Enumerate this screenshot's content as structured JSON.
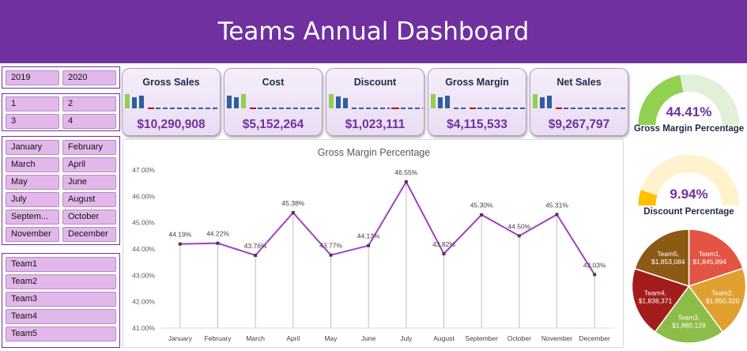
{
  "header": {
    "title": "Teams Annual Dashboard"
  },
  "slicers": {
    "years": [
      "2019",
      "2020"
    ],
    "quarters": [
      "1",
      "2",
      "3",
      "4"
    ],
    "months": [
      "January",
      "February",
      "March",
      "April",
      "May",
      "June",
      "July",
      "August",
      "Septem...",
      "October",
      "November",
      "December"
    ],
    "teams": [
      "Team1",
      "Team2",
      "Team3",
      "Team4",
      "Team5"
    ]
  },
  "kpis": [
    {
      "title": "Gross Sales",
      "value": "$10,290,908"
    },
    {
      "title": "Cost",
      "value": "$5,152,264"
    },
    {
      "title": "Discount",
      "value": "$1,023,111"
    },
    {
      "title": "Gross Margin",
      "value": "$4,115,533"
    },
    {
      "title": "Net Sales",
      "value": "$9,267,797"
    }
  ],
  "gauges": {
    "gross_margin": {
      "percent": "44.41%",
      "label": "Gross Margin Percentage",
      "fraction": 0.4441,
      "fill_color": "#92d050",
      "track_color": "#e2f0d9"
    },
    "discount": {
      "percent": "9.94%",
      "label": "Discount Percentage",
      "fraction": 0.0994,
      "fill_color": "#ffc000",
      "track_color": "#fff2cc"
    }
  },
  "chart_data": [
    {
      "type": "line",
      "title": "Gross Margin Percentage",
      "x": [
        "January",
        "February",
        "March",
        "April",
        "May",
        "June",
        "July",
        "August",
        "September",
        "October",
        "November",
        "December"
      ],
      "values": [
        44.19,
        44.22,
        43.76,
        45.38,
        43.77,
        44.13,
        46.55,
        43.82,
        45.3,
        44.5,
        45.31,
        43.03
      ],
      "data_labels": [
        "44.19%",
        "44.22%",
        "43.76%",
        "45.38%",
        "43.77%",
        "44.13%",
        "46.55%",
        "43.82%",
        "45.30%",
        "44.50%",
        "45.31%",
        "43.03%"
      ],
      "ylim": [
        41,
        47
      ],
      "y_ticks": [
        "41.00%",
        "42.00%",
        "43.00%",
        "44.00%",
        "45.00%",
        "46.00%",
        "47.00%"
      ],
      "grid": false,
      "line_color": "#a040c0"
    },
    {
      "type": "pie",
      "labels": [
        "Team1",
        "Team2",
        "Team3",
        "Team4",
        "Team5"
      ],
      "values": [
        1845894,
        1850320,
        1880128,
        1838371,
        1853084
      ],
      "value_labels": [
        "$1,845,894",
        "$1,850,320",
        "$1,880,128",
        "$1,838,371",
        "$1,853,084"
      ],
      "colors": [
        "#e45444",
        "#e0a030",
        "#8cbd48",
        "#a31c1c",
        "#8c5a14"
      ]
    }
  ]
}
